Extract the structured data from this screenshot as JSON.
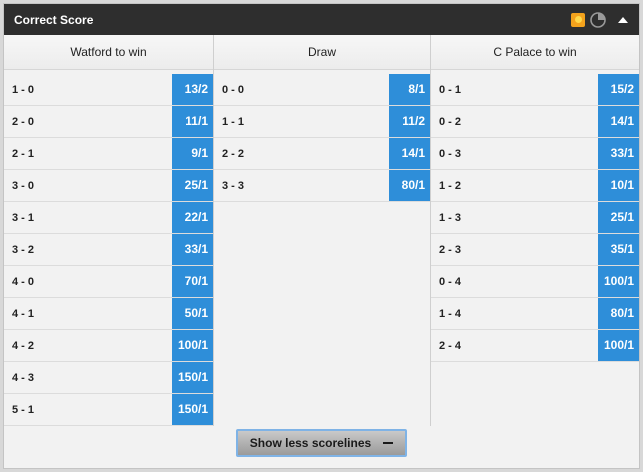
{
  "header": {
    "title": "Correct Score",
    "icons": [
      "sun-icon",
      "clock-icon",
      "collapse-icon"
    ]
  },
  "columns": [
    {
      "title": "Watford to win",
      "rows": [
        {
          "score": "1 - 0",
          "odds": "13/2"
        },
        {
          "score": "2 - 0",
          "odds": "11/1"
        },
        {
          "score": "2 - 1",
          "odds": "9/1"
        },
        {
          "score": "3 - 0",
          "odds": "25/1"
        },
        {
          "score": "3 - 1",
          "odds": "22/1"
        },
        {
          "score": "3 - 2",
          "odds": "33/1"
        },
        {
          "score": "4 - 0",
          "odds": "70/1"
        },
        {
          "score": "4 - 1",
          "odds": "50/1"
        },
        {
          "score": "4 - 2",
          "odds": "100/1"
        },
        {
          "score": "4 - 3",
          "odds": "150/1"
        },
        {
          "score": "5 - 1",
          "odds": "150/1"
        }
      ]
    },
    {
      "title": "Draw",
      "rows": [
        {
          "score": "0 - 0",
          "odds": "8/1"
        },
        {
          "score": "1 - 1",
          "odds": "11/2"
        },
        {
          "score": "2 - 2",
          "odds": "14/1"
        },
        {
          "score": "3 - 3",
          "odds": "80/1"
        }
      ]
    },
    {
      "title": "C Palace to win",
      "rows": [
        {
          "score": "0 - 1",
          "odds": "15/2"
        },
        {
          "score": "0 - 2",
          "odds": "14/1"
        },
        {
          "score": "0 - 3",
          "odds": "33/1"
        },
        {
          "score": "1 - 2",
          "odds": "10/1"
        },
        {
          "score": "1 - 3",
          "odds": "25/1"
        },
        {
          "score": "2 - 3",
          "odds": "35/1"
        },
        {
          "score": "0 - 4",
          "odds": "100/1"
        },
        {
          "score": "1 - 4",
          "odds": "80/1"
        },
        {
          "score": "2 - 4",
          "odds": "100/1"
        }
      ]
    }
  ],
  "footer": {
    "button_label": "Show less scorelines",
    "button_icon": "minus-icon"
  },
  "colors": {
    "header_bg": "#2e2e2e",
    "odds_bg": "#2e8ed9",
    "button_border": "#7fb3e6"
  }
}
